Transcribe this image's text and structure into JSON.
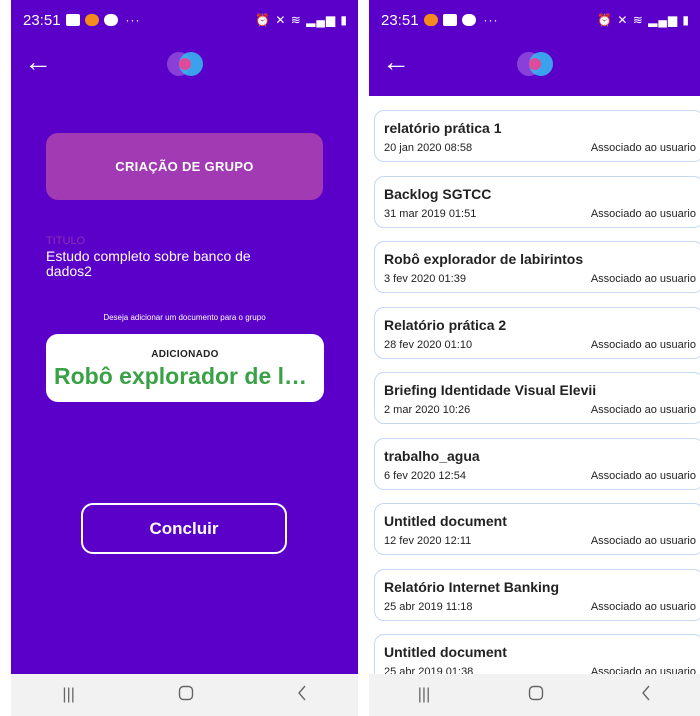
{
  "left": {
    "status": {
      "time": "23:51",
      "dots": "···"
    },
    "header_title": "CRIAÇÃO DE GRUPO",
    "title_label": "TITULO",
    "title_value": "Estudo completo sobre banco de dados2",
    "document_prompt": "Deseja adicionar um documento para o grupo",
    "document_status": "ADICIONADO",
    "document_name": "Robô explorador de labirintos",
    "finish_label": "Concluir"
  },
  "right": {
    "status": {
      "time": "23:51",
      "dots": "···"
    },
    "documents": [
      {
        "title": "relatório prática 1",
        "date": "20 jan 2020 08:58",
        "status": "Associado ao usuario"
      },
      {
        "title": "Backlog SGTCC",
        "date": "31 mar 2019 01:51",
        "status": "Associado ao usuario"
      },
      {
        "title": "Robô explorador de labirintos",
        "date": "3 fev 2020 01:39",
        "status": "Associado ao usuario"
      },
      {
        "title": "Relatório prática 2",
        "date": "28 fev 2020 01:10",
        "status": "Associado ao usuario"
      },
      {
        "title": "Briefing Identidade Visual Elevii",
        "date": "2 mar 2020 10:26",
        "status": "Associado ao usuario"
      },
      {
        "title": "trabalho_agua",
        "date": "6 fev 2020 12:54",
        "status": "Associado ao usuario"
      },
      {
        "title": "Untitled document",
        "date": "12 fev 2020 12:11",
        "status": "Associado ao usuario"
      },
      {
        "title": "Relatório Internet Banking",
        "date": "25 abr 2019 11:18",
        "status": "Associado ao usuario"
      },
      {
        "title": "Untitled document",
        "date": "25 abr 2019 01:38",
        "status": "Associado ao usuario"
      }
    ]
  },
  "colors": {
    "primary": "#5a00c8",
    "header_card": "#a13ab3",
    "added_green": "#3aa146",
    "card_border": "#c7d8ef"
  },
  "icons": [
    "back-arrow-icon",
    "app-logo-icon",
    "recents-icon",
    "home-icon",
    "nav-back-icon"
  ]
}
